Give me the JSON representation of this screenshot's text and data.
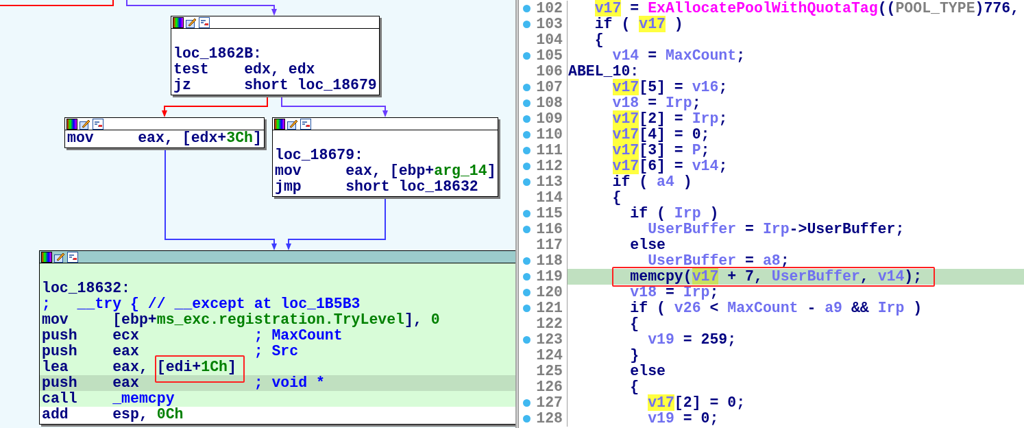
{
  "graph": {
    "nodes": [
      {
        "selected": false,
        "lines": [
          {
            "selected": false,
            "current": false,
            "tokens": [
              {
                "t": "loc_1862B:",
                "kind": "op"
              }
            ]
          },
          {
            "selected": false,
            "current": false,
            "tokens": [
              {
                "t": "test    edx, edx",
                "kind": "op"
              }
            ]
          },
          {
            "selected": false,
            "current": false,
            "tokens": [
              {
                "t": "jz      short loc_18679",
                "kind": "op"
              }
            ]
          }
        ]
      },
      {
        "selected": false,
        "lines": [
          {
            "selected": false,
            "current": false,
            "tokens": [
              {
                "t": "mov     eax, [edx+",
                "kind": "op"
              },
              {
                "t": "3Ch",
                "kind": "num"
              },
              {
                "t": "]",
                "kind": "op"
              }
            ]
          }
        ]
      },
      {
        "selected": false,
        "lines": [
          {
            "selected": false,
            "current": false,
            "tokens": [
              {
                "t": "loc_18679:",
                "kind": "op"
              }
            ]
          },
          {
            "selected": false,
            "current": false,
            "tokens": [
              {
                "t": "mov     eax, [ebp+",
                "kind": "op"
              },
              {
                "t": "arg_14",
                "kind": "num"
              },
              {
                "t": "]",
                "kind": "op"
              }
            ]
          },
          {
            "selected": false,
            "current": false,
            "tokens": [
              {
                "t": "jmp     short loc_18632",
                "kind": "op"
              }
            ]
          }
        ]
      },
      {
        "selected": true,
        "lines": [
          {
            "selected": true,
            "current": false,
            "tokens": [
              {
                "t": "loc_18632:",
                "kind": "op"
              }
            ]
          },
          {
            "selected": true,
            "current": false,
            "tokens": [
              {
                "t": ";   __try { // __except at loc_1B5B3",
                "kind": "cmt"
              }
            ]
          },
          {
            "selected": true,
            "current": false,
            "tokens": [
              {
                "t": "mov     [ebp+",
                "kind": "op"
              },
              {
                "t": "ms_exc.registration.TryLevel",
                "kind": "num"
              },
              {
                "t": "], ",
                "kind": "op"
              },
              {
                "t": "0",
                "kind": "num"
              }
            ]
          },
          {
            "selected": true,
            "current": false,
            "tokens": [
              {
                "t": "push    ecx             ",
                "kind": "op"
              },
              {
                "t": "; MaxCount",
                "kind": "cmt"
              }
            ]
          },
          {
            "selected": true,
            "current": false,
            "tokens": [
              {
                "t": "push    eax             ",
                "kind": "op"
              },
              {
                "t": "; Src",
                "kind": "cmt"
              }
            ]
          },
          {
            "selected": true,
            "current": false,
            "tokens": [
              {
                "t": "lea     eax, [edi+",
                "kind": "op"
              },
              {
                "t": "1Ch",
                "kind": "num"
              },
              {
                "t": "]",
                "kind": "op"
              }
            ]
          },
          {
            "selected": true,
            "current": true,
            "tokens": [
              {
                "t": "push    eax             ",
                "kind": "op"
              },
              {
                "t": "; void *",
                "kind": "cmt"
              }
            ]
          },
          {
            "selected": true,
            "current": false,
            "tokens": [
              {
                "t": "call    ",
                "kind": "op"
              },
              {
                "t": "_memcpy",
                "kind": "cmt"
              }
            ]
          },
          {
            "selected": false,
            "current": false,
            "tokens": [
              {
                "t": "add     esp, ",
                "kind": "op"
              },
              {
                "t": "0Ch",
                "kind": "num"
              }
            ]
          }
        ]
      }
    ],
    "edges": [
      {
        "color": "#ff0000"
      },
      {
        "color": "#6a3cff"
      },
      {
        "color": "#ff0000"
      },
      {
        "color": "#6a3cff"
      },
      {
        "color": "#3c3cff"
      },
      {
        "color": "#3c3cff"
      }
    ]
  },
  "pseudocode": {
    "lines": [
      {
        "num": "102",
        "dot": true,
        "current": false,
        "tokens": [
          {
            "t": "   v17",
            "kind": "hl"
          },
          {
            "t": " = ",
            "kind": "op"
          },
          {
            "t": "ExAllocatePoolWithQuotaTag",
            "kind": "func"
          },
          {
            "t": "((",
            "kind": "op"
          },
          {
            "t": "POOL_TYPE",
            "kind": "type"
          },
          {
            "t": ")776,",
            "kind": "op"
          }
        ]
      },
      {
        "num": "103",
        "dot": true,
        "current": false,
        "tokens": [
          {
            "t": "   if ( ",
            "kind": "op"
          },
          {
            "t": "v17",
            "kind": "hl"
          },
          {
            "t": " )",
            "kind": "op"
          }
        ]
      },
      {
        "num": "104",
        "dot": false,
        "current": false,
        "tokens": [
          {
            "t": "   {",
            "kind": "op"
          }
        ]
      },
      {
        "num": "105",
        "dot": true,
        "current": false,
        "tokens": [
          {
            "t": "     v14",
            "kind": "var"
          },
          {
            "t": " = ",
            "kind": "op"
          },
          {
            "t": "MaxCount",
            "kind": "var"
          },
          {
            "t": ";",
            "kind": "op"
          }
        ]
      },
      {
        "num": "106",
        "dot": false,
        "current": false,
        "tokens": [
          {
            "t": "ABEL_10:",
            "kind": "op"
          }
        ]
      },
      {
        "num": "107",
        "dot": true,
        "current": false,
        "tokens": [
          {
            "t": "     v17",
            "kind": "hl"
          },
          {
            "t": "[5] = ",
            "kind": "op"
          },
          {
            "t": "v16",
            "kind": "var"
          },
          {
            "t": ";",
            "kind": "op"
          }
        ]
      },
      {
        "num": "108",
        "dot": true,
        "current": false,
        "tokens": [
          {
            "t": "     v18",
            "kind": "var"
          },
          {
            "t": " = ",
            "kind": "op"
          },
          {
            "t": "Irp",
            "kind": "var"
          },
          {
            "t": ";",
            "kind": "op"
          }
        ]
      },
      {
        "num": "109",
        "dot": true,
        "current": false,
        "tokens": [
          {
            "t": "     v17",
            "kind": "hl"
          },
          {
            "t": "[2] = ",
            "kind": "op"
          },
          {
            "t": "Irp",
            "kind": "var"
          },
          {
            "t": ";",
            "kind": "op"
          }
        ]
      },
      {
        "num": "110",
        "dot": true,
        "current": false,
        "tokens": [
          {
            "t": "     v17",
            "kind": "hl"
          },
          {
            "t": "[4] = 0;",
            "kind": "op"
          }
        ]
      },
      {
        "num": "111",
        "dot": true,
        "current": false,
        "tokens": [
          {
            "t": "     v17",
            "kind": "hl"
          },
          {
            "t": "[3] = ",
            "kind": "op"
          },
          {
            "t": "P",
            "kind": "var"
          },
          {
            "t": ";",
            "kind": "op"
          }
        ]
      },
      {
        "num": "112",
        "dot": true,
        "current": false,
        "tokens": [
          {
            "t": "     v17",
            "kind": "hl"
          },
          {
            "t": "[6] = ",
            "kind": "op"
          },
          {
            "t": "v14",
            "kind": "var"
          },
          {
            "t": ";",
            "kind": "op"
          }
        ]
      },
      {
        "num": "113",
        "dot": true,
        "current": false,
        "tokens": [
          {
            "t": "     if ( ",
            "kind": "op"
          },
          {
            "t": "a4",
            "kind": "var"
          },
          {
            "t": " )",
            "kind": "op"
          }
        ]
      },
      {
        "num": "114",
        "dot": false,
        "current": false,
        "tokens": [
          {
            "t": "     {",
            "kind": "op"
          }
        ]
      },
      {
        "num": "115",
        "dot": true,
        "current": false,
        "tokens": [
          {
            "t": "       if ( ",
            "kind": "op"
          },
          {
            "t": "Irp",
            "kind": "var"
          },
          {
            "t": " )",
            "kind": "op"
          }
        ]
      },
      {
        "num": "116",
        "dot": true,
        "current": false,
        "tokens": [
          {
            "t": "         UserBuffer",
            "kind": "var"
          },
          {
            "t": " = ",
            "kind": "op"
          },
          {
            "t": "Irp",
            "kind": "var"
          },
          {
            "t": "->UserBuffer;",
            "kind": "op"
          }
        ]
      },
      {
        "num": "117",
        "dot": false,
        "current": false,
        "tokens": [
          {
            "t": "       else",
            "kind": "op"
          }
        ]
      },
      {
        "num": "118",
        "dot": true,
        "current": false,
        "tokens": [
          {
            "t": "         UserBuffer",
            "kind": "var"
          },
          {
            "t": " = ",
            "kind": "op"
          },
          {
            "t": "a8",
            "kind": "var"
          },
          {
            "t": ";",
            "kind": "op"
          }
        ]
      },
      {
        "num": "119",
        "dot": true,
        "current": true,
        "tokens": [
          {
            "t": "       memcpy(",
            "kind": "op"
          },
          {
            "t": "v17",
            "kind": "hlcur"
          },
          {
            "t": " + 7, ",
            "kind": "op"
          },
          {
            "t": "UserBuffer",
            "kind": "var"
          },
          {
            "t": ", ",
            "kind": "op"
          },
          {
            "t": "v14",
            "kind": "var"
          },
          {
            "t": ");",
            "kind": "op"
          }
        ]
      },
      {
        "num": "120",
        "dot": true,
        "current": false,
        "tokens": [
          {
            "t": "       v18",
            "kind": "var"
          },
          {
            "t": " = ",
            "kind": "op"
          },
          {
            "t": "Irp",
            "kind": "var"
          },
          {
            "t": ";",
            "kind": "op"
          }
        ]
      },
      {
        "num": "121",
        "dot": true,
        "current": false,
        "tokens": [
          {
            "t": "       if ( ",
            "kind": "op"
          },
          {
            "t": "v26",
            "kind": "var"
          },
          {
            "t": " < ",
            "kind": "op"
          },
          {
            "t": "MaxCount",
            "kind": "var"
          },
          {
            "t": " - ",
            "kind": "op"
          },
          {
            "t": "a9",
            "kind": "var"
          },
          {
            "t": " && ",
            "kind": "op"
          },
          {
            "t": "Irp",
            "kind": "var"
          },
          {
            "t": " )",
            "kind": "op"
          }
        ]
      },
      {
        "num": "122",
        "dot": false,
        "current": false,
        "tokens": [
          {
            "t": "       {",
            "kind": "op"
          }
        ]
      },
      {
        "num": "123",
        "dot": true,
        "current": false,
        "tokens": [
          {
            "t": "         v19",
            "kind": "var"
          },
          {
            "t": " = 259;",
            "kind": "op"
          }
        ]
      },
      {
        "num": "124",
        "dot": false,
        "current": false,
        "tokens": [
          {
            "t": "       }",
            "kind": "op"
          }
        ]
      },
      {
        "num": "125",
        "dot": false,
        "current": false,
        "tokens": [
          {
            "t": "       else",
            "kind": "op"
          }
        ]
      },
      {
        "num": "126",
        "dot": false,
        "current": false,
        "tokens": [
          {
            "t": "       {",
            "kind": "op"
          }
        ]
      },
      {
        "num": "127",
        "dot": true,
        "current": false,
        "tokens": [
          {
            "t": "         v17",
            "kind": "hl"
          },
          {
            "t": "[2] = 0;",
            "kind": "op"
          }
        ]
      },
      {
        "num": "128",
        "dot": true,
        "current": false,
        "tokens": [
          {
            "t": "         v19",
            "kind": "var"
          },
          {
            "t": " = 0;",
            "kind": "op"
          }
        ]
      }
    ]
  }
}
